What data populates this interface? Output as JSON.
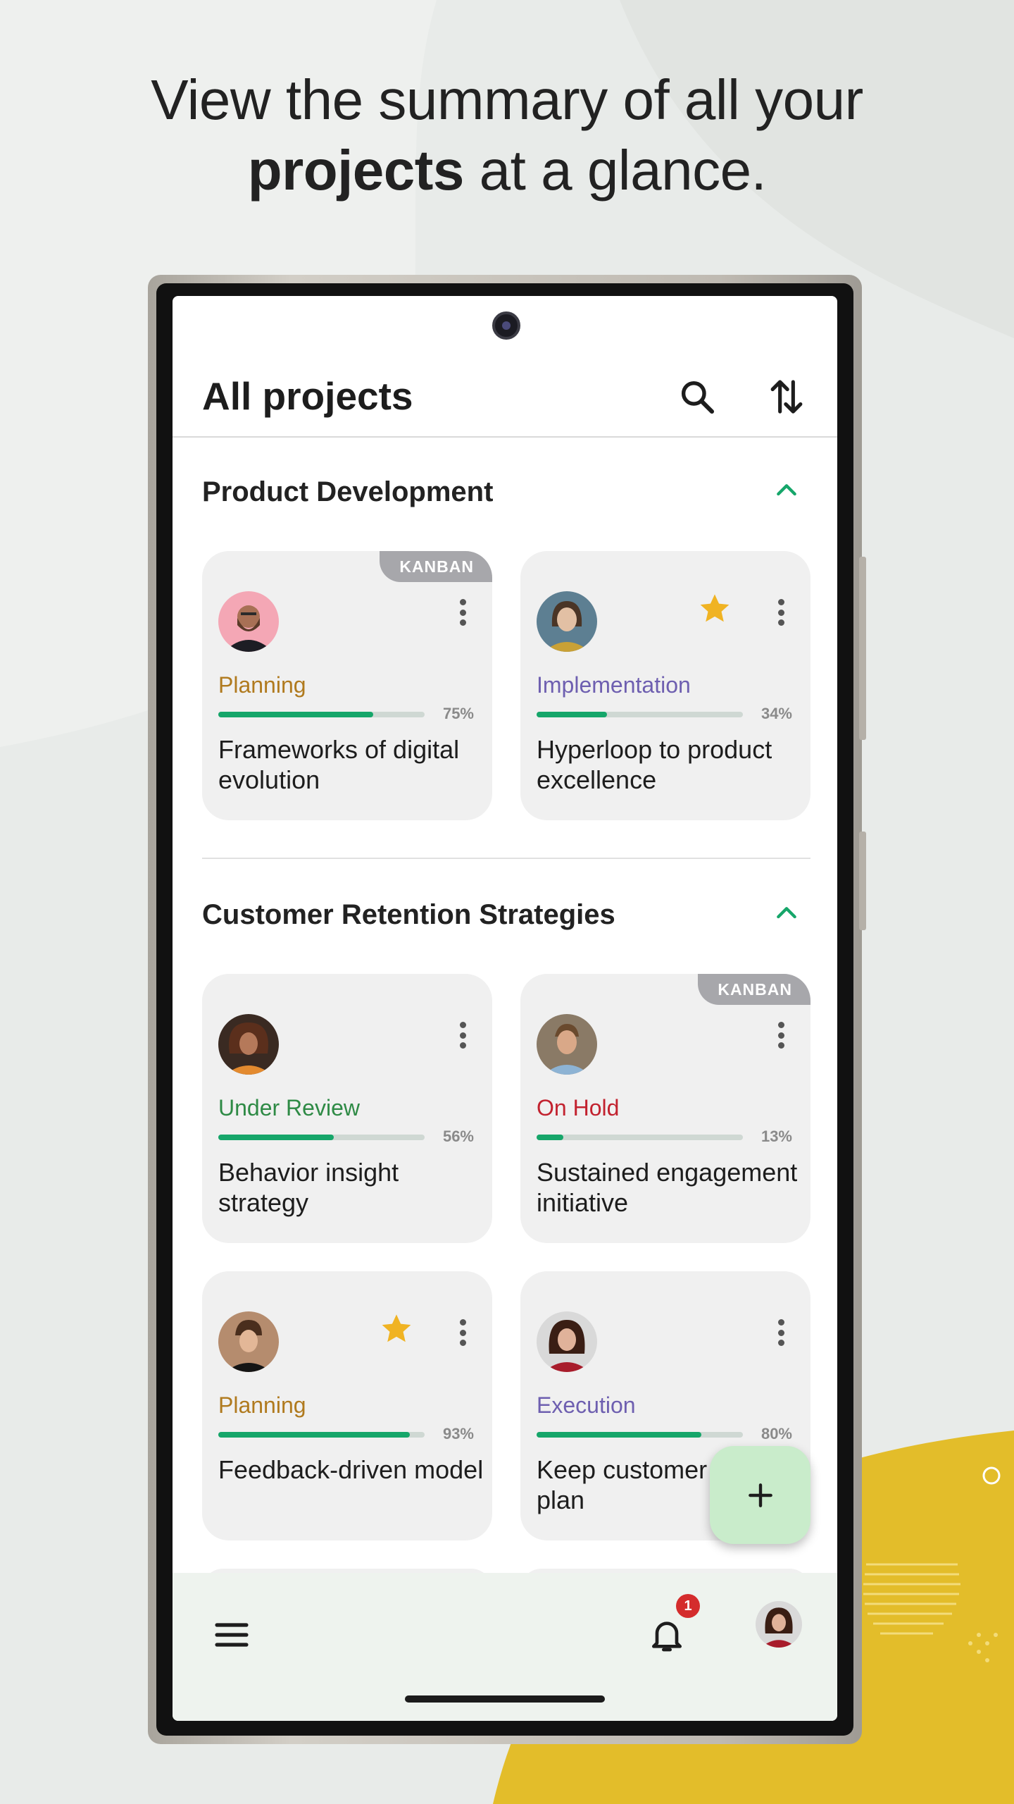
{
  "headline": {
    "line1": "View the summary of all your",
    "line2_bold": "projects",
    "line2_rest": " at a glance."
  },
  "appbar": {
    "title": "All projects"
  },
  "sections": [
    {
      "title": "Product Development"
    },
    {
      "title": "Customer Retention Strategies"
    }
  ],
  "cards": [
    {
      "status": "Planning",
      "status_color": "#b07a1e",
      "progress": 0.75,
      "pct": "75%",
      "title": "Frameworks of digital evolution",
      "kanban": "KANBAN",
      "starred": false
    },
    {
      "status": "Implementation",
      "status_color": "#6e5fb0",
      "progress": 0.34,
      "pct": "34%",
      "title": "Hyperloop to product excellence",
      "starred": true
    },
    {
      "status": "Under Review",
      "status_color": "#2e8a45",
      "progress": 0.56,
      "pct": "56%",
      "title": "Behavior insight strategy",
      "starred": false
    },
    {
      "status": "On Hold",
      "status_color": "#c2222f",
      "progress": 0.13,
      "pct": "13%",
      "title": "Sustained engagement initiative",
      "kanban": "KANBAN",
      "starred": false
    },
    {
      "status": "Planning",
      "status_color": "#b07a1e",
      "progress": 0.93,
      "pct": "93%",
      "title": "Feedback-driven model",
      "starred": true
    },
    {
      "status": "Execution",
      "status_color": "#6e5fb0",
      "progress": 0.8,
      "pct": "80%",
      "title": "Keep customer close plan",
      "starred": false
    }
  ],
  "notifications": {
    "count": "1"
  },
  "colors": {
    "accent": "#16a66a",
    "fab_bg": "#c9eccb",
    "kanban_tag": "#a7a7ab",
    "star": "#f0b323",
    "yellow_blob": "#e3bd2a"
  },
  "icons": [
    "search-icon",
    "sort-icon",
    "chevron-up-icon",
    "more-vert-icon",
    "star-icon",
    "add-icon",
    "menu-icon",
    "bell-icon"
  ]
}
